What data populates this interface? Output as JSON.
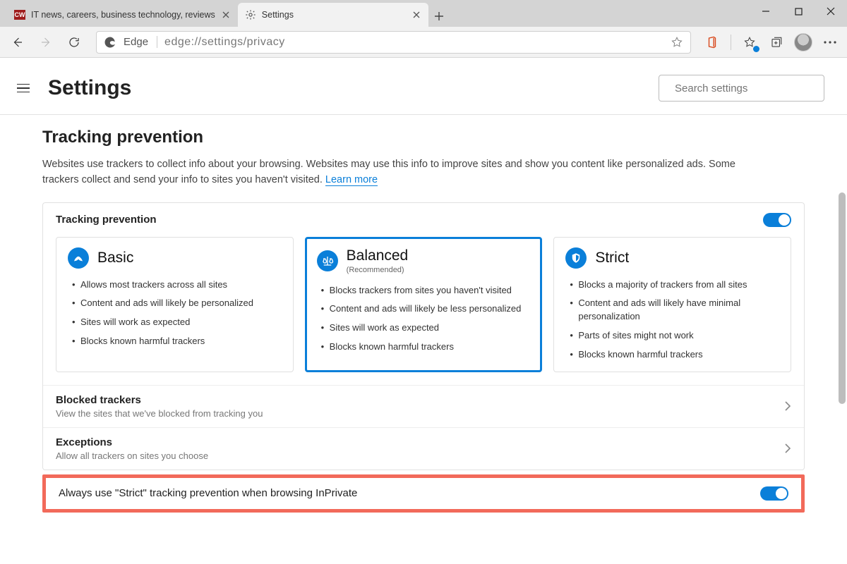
{
  "browser": {
    "tabs": [
      {
        "title": "IT news, careers, business technology, reviews",
        "favicon": "CW"
      },
      {
        "title": "Settings",
        "favicon": "gear",
        "active": true
      }
    ],
    "address": {
      "site_label": "Edge",
      "url": "edge://settings/privacy"
    }
  },
  "settings": {
    "page_title": "Settings",
    "search_placeholder": "Search settings",
    "section": {
      "heading": "Tracking prevention",
      "description": "Websites use trackers to collect info about your browsing. Websites may use this info to improve sites and show you content like personalized ads. Some trackers collect and send your info to sites you haven't visited. ",
      "learn_more": "Learn more",
      "card_title": "Tracking prevention",
      "toggle_on": true,
      "levels": [
        {
          "key": "basic",
          "name": "Basic",
          "selected": false,
          "bullets": [
            "Allows most trackers across all sites",
            "Content and ads will likely be personalized",
            "Sites will work as expected",
            "Blocks known harmful trackers"
          ]
        },
        {
          "key": "balanced",
          "name": "Balanced",
          "subtitle": "(Recommended)",
          "selected": true,
          "bullets": [
            "Blocks trackers from sites you haven't visited",
            "Content and ads will likely be less personalized",
            "Sites will work as expected",
            "Blocks known harmful trackers"
          ]
        },
        {
          "key": "strict",
          "name": "Strict",
          "selected": false,
          "bullets": [
            "Blocks a majority of trackers from all sites",
            "Content and ads will likely have minimal personalization",
            "Parts of sites might not work",
            "Blocks known harmful trackers"
          ]
        }
      ],
      "rows": {
        "blocked": {
          "title": "Blocked trackers",
          "sub": "View the sites that we've blocked from tracking you"
        },
        "exceptions": {
          "title": "Exceptions",
          "sub": "Allow all trackers on sites you choose"
        },
        "inprivate": {
          "title": "Always use \"Strict\" tracking prevention when browsing InPrivate",
          "toggle_on": true
        }
      }
    }
  }
}
